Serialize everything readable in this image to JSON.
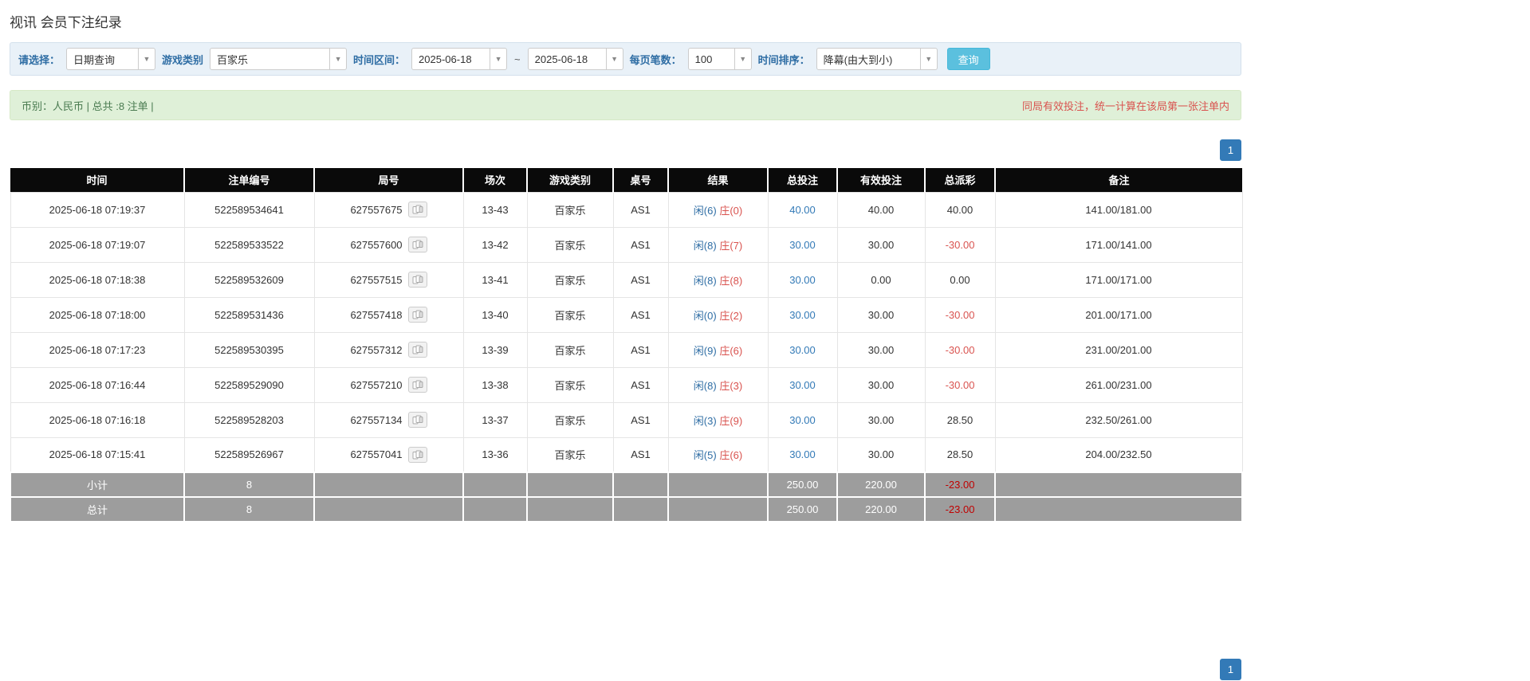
{
  "page": {
    "title": "视讯 会员下注纪录"
  },
  "filters": {
    "select_label": "请选择：",
    "select_value": "日期查询",
    "game_type_label": "游戏类别",
    "game_type_value": "百家乐",
    "date_range_label": "时间区间：",
    "date_from": "2025-06-18",
    "date_separator": "~",
    "date_to": "2025-06-18",
    "page_size_label": "每页笔数：",
    "page_size_value": "100",
    "sort_label": "时间排序：",
    "sort_value": "降幕(由大到小)",
    "search_button": "查询"
  },
  "summary": {
    "left": "币别：人民币 | 总共 :8 注单 |",
    "right": "同局有效投注，统一计算在该局第一张注单内"
  },
  "pagination": {
    "page": "1"
  },
  "table": {
    "headers": [
      "时间",
      "注单编号",
      "局号",
      "场次",
      "游戏类别",
      "桌号",
      "结果",
      "总投注",
      "有效投注",
      "总派彩",
      "备注"
    ],
    "rows": [
      {
        "time": "2025-06-18 07:19:37",
        "bet_id": "522589534641",
        "round_id": "627557675",
        "session": "13-43",
        "game": "百家乐",
        "table_no": "AS1",
        "result_player": "闲(6)",
        "result_banker": "庄(0)",
        "total_bet": "40.00",
        "valid_bet": "40.00",
        "payout": "40.00",
        "note": "141.00/181.00"
      },
      {
        "time": "2025-06-18 07:19:07",
        "bet_id": "522589533522",
        "round_id": "627557600",
        "session": "13-42",
        "game": "百家乐",
        "table_no": "AS1",
        "result_player": "闲(8)",
        "result_banker": "庄(7)",
        "total_bet": "30.00",
        "valid_bet": "30.00",
        "payout": "-30.00",
        "note": "171.00/141.00"
      },
      {
        "time": "2025-06-18 07:18:38",
        "bet_id": "522589532609",
        "round_id": "627557515",
        "session": "13-41",
        "game": "百家乐",
        "table_no": "AS1",
        "result_player": "闲(8)",
        "result_banker": "庄(8)",
        "total_bet": "30.00",
        "valid_bet": "0.00",
        "payout": "0.00",
        "note": "171.00/171.00"
      },
      {
        "time": "2025-06-18 07:18:00",
        "bet_id": "522589531436",
        "round_id": "627557418",
        "session": "13-40",
        "game": "百家乐",
        "table_no": "AS1",
        "result_player": "闲(0)",
        "result_banker": "庄(2)",
        "total_bet": "30.00",
        "valid_bet": "30.00",
        "payout": "-30.00",
        "note": "201.00/171.00"
      },
      {
        "time": "2025-06-18 07:17:23",
        "bet_id": "522589530395",
        "round_id": "627557312",
        "session": "13-39",
        "game": "百家乐",
        "table_no": "AS1",
        "result_player": "闲(9)",
        "result_banker": "庄(6)",
        "total_bet": "30.00",
        "valid_bet": "30.00",
        "payout": "-30.00",
        "note": "231.00/201.00"
      },
      {
        "time": "2025-06-18 07:16:44",
        "bet_id": "522589529090",
        "round_id": "627557210",
        "session": "13-38",
        "game": "百家乐",
        "table_no": "AS1",
        "result_player": "闲(8)",
        "result_banker": "庄(3)",
        "total_bet": "30.00",
        "valid_bet": "30.00",
        "payout": "-30.00",
        "note": "261.00/231.00"
      },
      {
        "time": "2025-06-18 07:16:18",
        "bet_id": "522589528203",
        "round_id": "627557134",
        "session": "13-37",
        "game": "百家乐",
        "table_no": "AS1",
        "result_player": "闲(3)",
        "result_banker": "庄(9)",
        "total_bet": "30.00",
        "valid_bet": "30.00",
        "payout": "28.50",
        "note": "232.50/261.00"
      },
      {
        "time": "2025-06-18 07:15:41",
        "bet_id": "522589526967",
        "round_id": "627557041",
        "session": "13-36",
        "game": "百家乐",
        "table_no": "AS1",
        "result_player": "闲(5)",
        "result_banker": "庄(6)",
        "total_bet": "30.00",
        "valid_bet": "30.00",
        "payout": "28.50",
        "note": "204.00/232.50"
      }
    ],
    "subtotal": {
      "label": "小计",
      "count": "8",
      "total_bet": "250.00",
      "valid_bet": "220.00",
      "payout": "-23.00"
    },
    "total": {
      "label": "总计",
      "count": "8",
      "total_bet": "250.00",
      "valid_bet": "220.00",
      "payout": "-23.00"
    }
  }
}
